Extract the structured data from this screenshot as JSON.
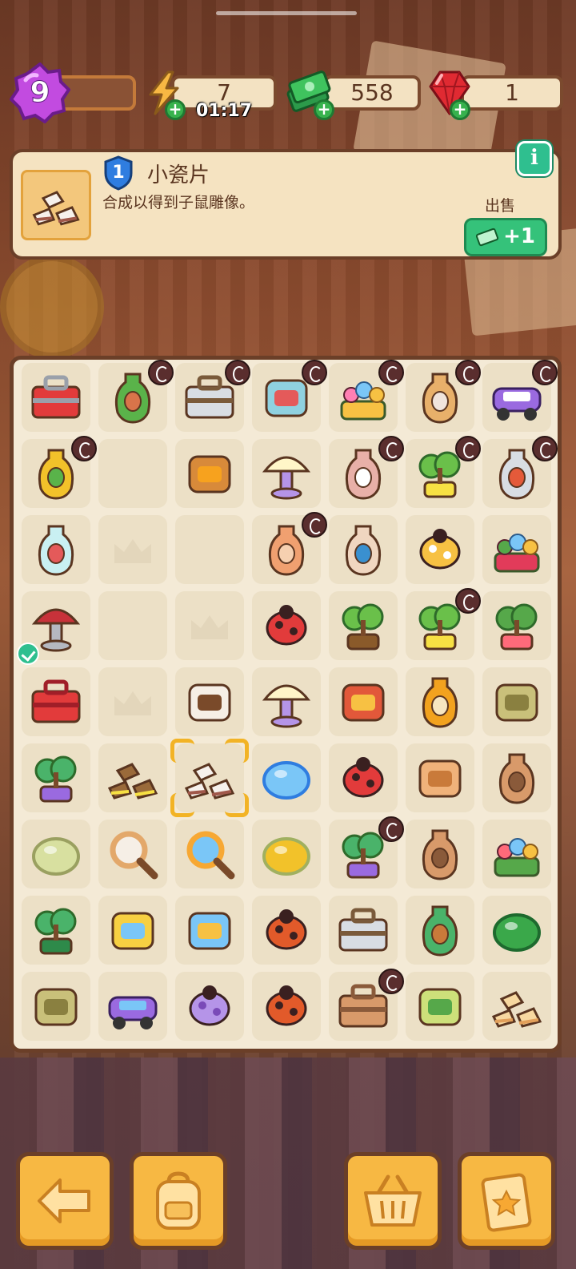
{
  "hud": {
    "level": "9",
    "energy": {
      "value": "7",
      "timer": "01:17"
    },
    "cash": "558",
    "gems": "1"
  },
  "item_info": {
    "item_level": "1",
    "title": "小瓷片",
    "description": "合成以得到子鼠雕像。",
    "sell_label": "出售",
    "sell_value": "+1",
    "info_label": "i"
  },
  "board": {
    "rows": [
      [
        {
          "icon": "toolbox-generator-icon",
          "lock": false
        },
        {
          "icon": "potted-plant-icon",
          "lock": true
        },
        {
          "icon": "evidence-tray-icon",
          "lock": true
        },
        {
          "icon": "mortar-medicine-icon",
          "lock": true
        },
        {
          "icon": "flower-basket-icon",
          "lock": true
        },
        {
          "icon": "pottery-crate-icon",
          "lock": true
        },
        {
          "icon": "purple-car-icon",
          "lock": true
        }
      ],
      [
        {
          "icon": "honey-pot-icon",
          "lock": true
        },
        {
          "icon": "",
          "lock": false
        },
        {
          "icon": "honey-dipper-icon",
          "lock": false
        },
        {
          "icon": "lamp-icon",
          "lock": false
        },
        {
          "icon": "vase-pink-icon",
          "lock": true
        },
        {
          "icon": "bonsai-flower-icon",
          "lock": true
        },
        {
          "icon": "vase-ornate-icon",
          "lock": true
        }
      ],
      [
        {
          "icon": "medicine-jar-icon",
          "lock": false
        },
        {
          "icon": "crown-placeholder-icon",
          "lock": false
        },
        {
          "icon": "",
          "lock": false
        },
        {
          "icon": "vase-orange-icon",
          "lock": true
        },
        {
          "icon": "vase-blue-icon",
          "lock": false
        },
        {
          "icon": "bee-icon",
          "lock": false
        },
        {
          "icon": "flower-bed-icon",
          "lock": false
        }
      ],
      [
        {
          "icon": "mushroom-icon",
          "lock": false,
          "check": true
        },
        {
          "icon": "",
          "lock": false
        },
        {
          "icon": "crown-placeholder-icon",
          "lock": false
        },
        {
          "icon": "ladybug-icon",
          "lock": false
        },
        {
          "icon": "sprout-icon",
          "lock": false
        },
        {
          "icon": "bonsai-flower-icon",
          "lock": true
        },
        {
          "icon": "flower-bush-icon",
          "lock": false
        }
      ],
      [
        {
          "icon": "red-toolbox-icon",
          "lock": false
        },
        {
          "icon": "crown-placeholder-icon",
          "lock": false
        },
        {
          "icon": "footprint-bag-icon",
          "lock": false
        },
        {
          "icon": "lamp-bunch-icon",
          "lock": false
        },
        {
          "icon": "pouch-icon",
          "lock": false
        },
        {
          "icon": "honey-jar-icon",
          "lock": false
        },
        {
          "icon": "seed-packets-icon",
          "lock": false
        }
      ],
      [
        {
          "icon": "bonsai-small-icon",
          "lock": false
        },
        {
          "icon": "evidence-markers-icon",
          "lock": false
        },
        {
          "icon": "porcelain-shards-icon",
          "lock": false,
          "selected": true
        },
        {
          "icon": "blue-gem-icon",
          "lock": false
        },
        {
          "icon": "ladybug-big-icon",
          "lock": false
        },
        {
          "icon": "envelope-icon",
          "lock": false
        },
        {
          "icon": "broken-pot-icon",
          "lock": false
        }
      ],
      [
        {
          "icon": "soap-icon",
          "lock": false
        },
        {
          "icon": "pocket-watch-icon",
          "lock": false
        },
        {
          "icon": "magnifier-icon",
          "lock": false
        },
        {
          "icon": "tape-roll-icon",
          "lock": false
        },
        {
          "icon": "bonsai-green-icon",
          "lock": true
        },
        {
          "icon": "broken-vase-icon",
          "lock": false
        },
        {
          "icon": "flower-cart-icon",
          "lock": false
        }
      ],
      [
        {
          "icon": "leaf-sprout-icon",
          "lock": false
        },
        {
          "icon": "bucket-icon",
          "lock": false
        },
        {
          "icon": "sunglasses-icon",
          "lock": false
        },
        {
          "icon": "ladybugs-icon",
          "lock": false
        },
        {
          "icon": "evidence-tray-icon",
          "lock": false
        },
        {
          "icon": "bonsai-pot-icon",
          "lock": false
        },
        {
          "icon": "sponge-icon",
          "lock": false
        }
      ],
      [
        {
          "icon": "seed-stack-icon",
          "lock": false
        },
        {
          "icon": "scooter-icon",
          "lock": false
        },
        {
          "icon": "moth-icon",
          "lock": false
        },
        {
          "icon": "ladybugs-icon",
          "lock": false
        },
        {
          "icon": "box-icon",
          "lock": true
        },
        {
          "icon": "shoe-horn-icon",
          "lock": false
        },
        {
          "icon": "sugar-cubes-icon",
          "lock": false
        }
      ]
    ]
  },
  "toolbar": [
    {
      "icon": "back-arrow-icon"
    },
    {
      "icon": "backpack-icon"
    },
    {
      "icon": "basket-icon"
    },
    {
      "icon": "clipboard-star-icon"
    }
  ],
  "colors": {
    "accent": "#f7b843",
    "green": "#35c27a",
    "panel": "#f5e3c1",
    "border": "#6b3f28"
  }
}
